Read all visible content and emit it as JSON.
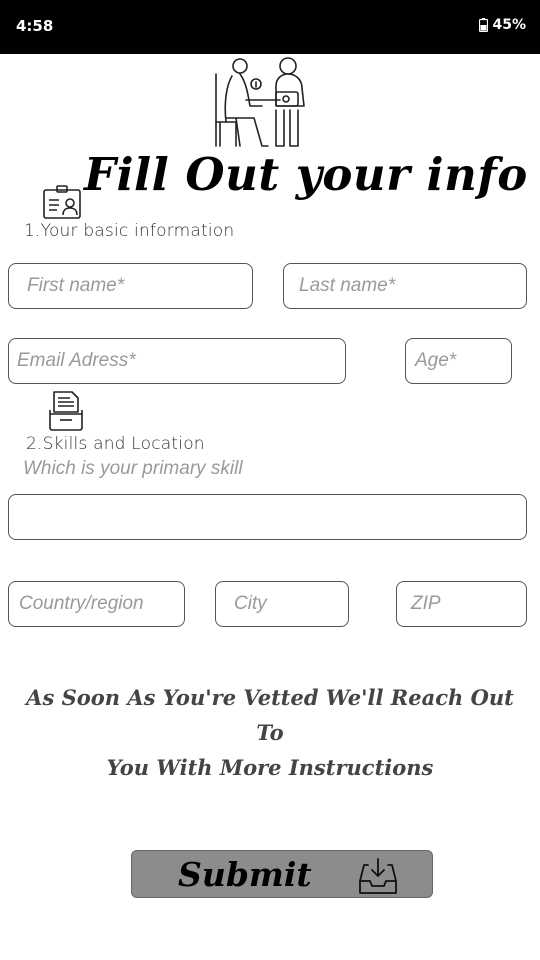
{
  "status_bar": {
    "time": "4:58",
    "battery": "45%",
    "icons": [
      "battery-icon"
    ]
  },
  "header": {
    "title": "Fill Out your info",
    "illustration": "two-people-desk-illustration"
  },
  "section1": {
    "icon": "id-card-icon",
    "label": "1.Your basic information"
  },
  "fields": {
    "first_name": {
      "placeholder": "First name*"
    },
    "last_name": {
      "placeholder": "Last name*"
    },
    "email": {
      "placeholder": "Email Adress*"
    },
    "age": {
      "placeholder": "Age*"
    },
    "skill": {
      "placeholder": ""
    },
    "country": {
      "placeholder": "Country/region"
    },
    "city": {
      "placeholder": "City"
    },
    "zip": {
      "placeholder": "ZIP"
    }
  },
  "section2": {
    "icon": "document-folder-icon",
    "label": "2.Skills and Location",
    "skill_prompt": "Which is your primary skill"
  },
  "message": {
    "line1": "As Soon As You're Vetted We'll Reach Out To",
    "line2": "You With More Instructions"
  },
  "submit": {
    "label": "Submit",
    "icon": "inbox-download-icon",
    "color": "#8c8c8c"
  }
}
